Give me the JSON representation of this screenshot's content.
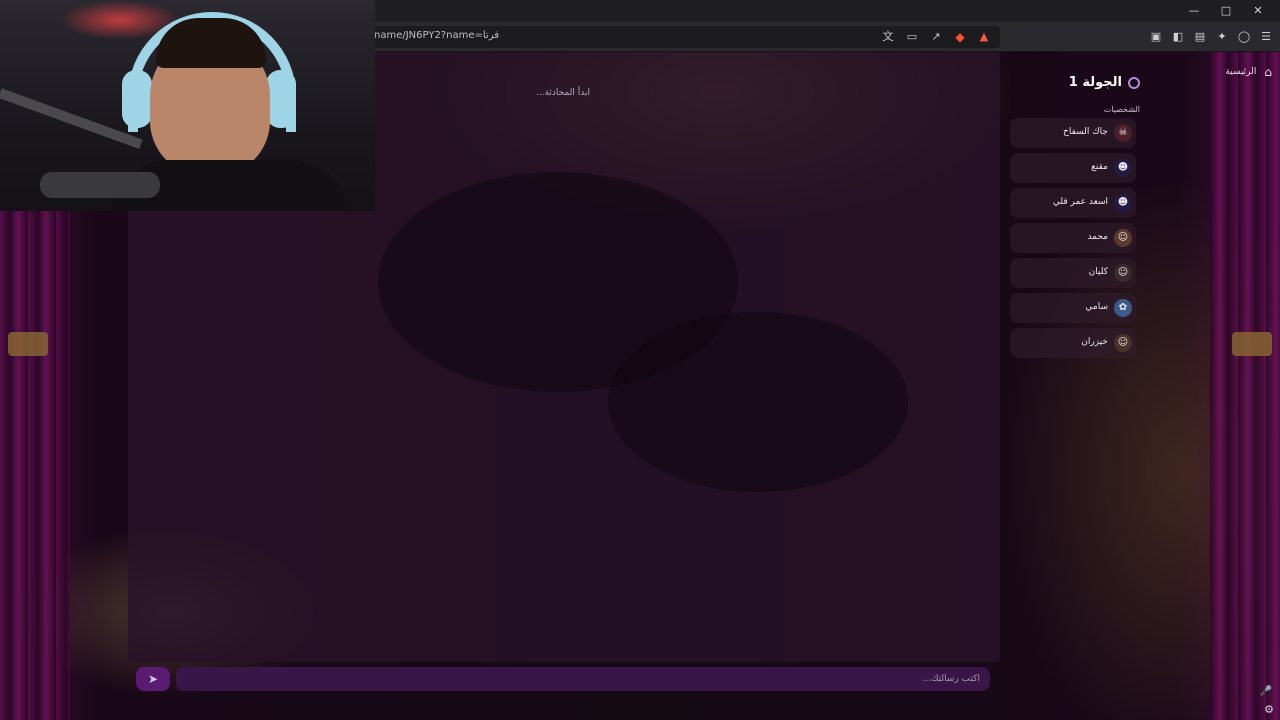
{
  "browser": {
    "url": "name/JN6PY2?name=فرتا",
    "window_controls": [
      "minimize",
      "maximize",
      "close"
    ]
  },
  "sidebar": {
    "home_label": "الرئيسية",
    "round_title": "الجولة 1",
    "characters_heading": "الشخصيات",
    "characters": [
      {
        "name": "جاك السفاح",
        "avatar": "☠"
      },
      {
        "name": "مقنع",
        "avatar": "☻"
      },
      {
        "name": "اسعد عمر قلي",
        "avatar": "☻"
      },
      {
        "name": "محمد",
        "avatar": "☺"
      },
      {
        "name": "كليان",
        "avatar": "☺"
      },
      {
        "name": "سامي",
        "avatar": "✿"
      },
      {
        "name": "خيزران",
        "avatar": "☺"
      }
    ]
  },
  "chat": {
    "empty_state": "ابدأ المحادثة...",
    "input_placeholder": "اكتب رسالتك...",
    "send_icon": "➤"
  },
  "colors": {
    "accent": "#5a1b73",
    "panel": "#281228",
    "round_icon": "#b58ad6"
  }
}
